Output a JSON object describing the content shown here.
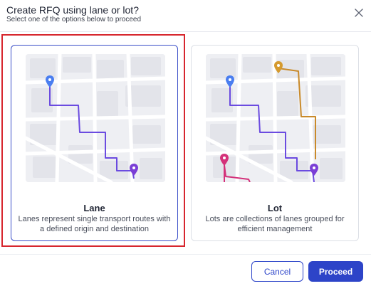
{
  "dialog": {
    "title": "Create RFQ using lane or lot?",
    "subtitle": "Select one of the options below to proceed"
  },
  "options": [
    {
      "key": "lane",
      "title": "Lane",
      "description": "Lanes represent single transport routes with a defined origin and destination",
      "selected": true
    },
    {
      "key": "lot",
      "title": "Lot",
      "description": "Lots are collections of lanes grouped for efficient management",
      "selected": false
    }
  ],
  "footer": {
    "cancel_label": "Cancel",
    "proceed_label": "Proceed"
  },
  "colors": {
    "primary": "#2d44c8",
    "selection_highlight": "#d7262e",
    "route_blue_purple": "#6b4be0",
    "route_orange": "#c98a2a",
    "route_magenta": "#d4317a"
  },
  "icons": [
    "close-icon",
    "map-pin-icon"
  ]
}
